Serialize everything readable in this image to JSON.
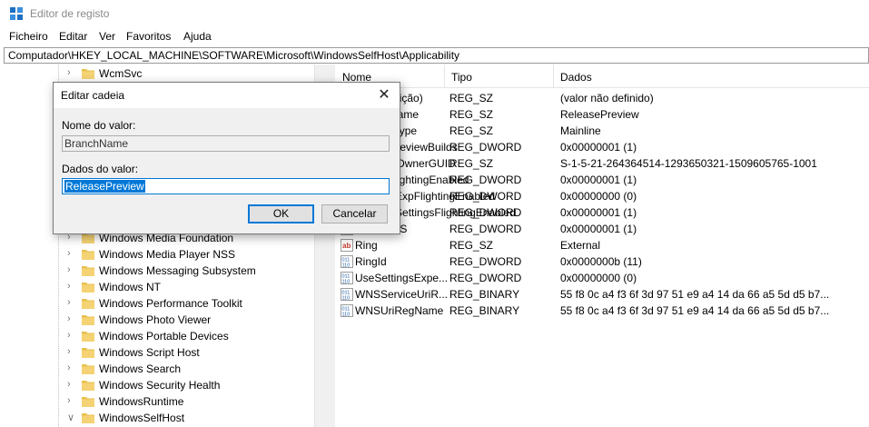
{
  "window": {
    "title": "Editor de registo",
    "icon": "registry-editor-icon"
  },
  "menu": [
    "Ficheiro",
    "Editar",
    "Ver",
    "Favoritos",
    "Ajuda"
  ],
  "address": "Computador\\HKEY_LOCAL_MACHINE\\SOFTWARE\\Microsoft\\WindowsSelfHost\\Applicability",
  "tree": {
    "items": [
      {
        "label": "WcmSvc",
        "expander": "chevron-right-icon"
      },
      {
        "label": "Windows Media Foundation",
        "expander": "chevron-right-icon"
      },
      {
        "label": "Windows Media Player NSS",
        "expander": "chevron-right-icon"
      },
      {
        "label": "Windows Messaging Subsystem",
        "expander": "chevron-right-icon"
      },
      {
        "label": "Windows NT",
        "expander": "chevron-right-icon"
      },
      {
        "label": "Windows Performance Toolkit",
        "expander": "chevron-right-icon"
      },
      {
        "label": "Windows Photo Viewer",
        "expander": "chevron-right-icon"
      },
      {
        "label": "Windows Portable Devices",
        "expander": "chevron-right-icon"
      },
      {
        "label": "Windows Script Host",
        "expander": "chevron-right-icon"
      },
      {
        "label": "Windows Search",
        "expander": "chevron-right-icon"
      },
      {
        "label": "Windows Security Health",
        "expander": "chevron-right-icon"
      },
      {
        "label": "WindowsRuntime",
        "expander": "chevron-right-icon"
      },
      {
        "label": "WindowsSelfHost",
        "expander": "chevron-down-icon"
      }
    ]
  },
  "list": {
    "columns": [
      "Nome",
      "Tipo",
      "Dados"
    ],
    "rows": [
      {
        "name": "(Predefinição)",
        "type": "REG_SZ",
        "data": "(valor não definido)",
        "icon": "string-value-icon"
      },
      {
        "name": "BranchName",
        "type": "REG_SZ",
        "data": "ReleasePreview",
        "icon": "string-value-icon"
      },
      {
        "name": "ContentType",
        "type": "REG_SZ",
        "data": "Mainline",
        "icon": "string-value-icon"
      },
      {
        "name": "EnablePreviewBuilds",
        "type": "REG_DWORD",
        "data": "0x00000001 (1)",
        "icon": "binary-value-icon"
      },
      {
        "name": "FlightingOwnerGUID",
        "type": "REG_SZ",
        "data": "S-1-5-21-264364514-1293650321-1509605765-1001",
        "icon": "string-value-icon"
      },
      {
        "name": "IsBuildFlightingEnabled",
        "type": "REG_DWORD",
        "data": "0x00000001 (1)",
        "icon": "binary-value-icon"
      },
      {
        "name": "IsConfigExpFlightingEnabled",
        "type": "REG_DWORD",
        "data": "0x00000000 (0)",
        "icon": "binary-value-icon"
      },
      {
        "name": "IsConfigSettingsFlightingEnabled",
        "type": "REG_DWORD",
        "data": "0x00000001 (1)",
        "icon": "binary-value-icon"
      },
      {
        "name": "IsRetailOS",
        "type": "REG_DWORD",
        "data": "0x00000001 (1)",
        "icon": "binary-value-icon"
      },
      {
        "name": "Ring",
        "type": "REG_SZ",
        "data": "External",
        "icon": "string-value-icon"
      },
      {
        "name": "RingId",
        "type": "REG_DWORD",
        "data": "0x0000000b (11)",
        "icon": "binary-value-icon"
      },
      {
        "name": "UseSettingsExpe...",
        "type": "REG_DWORD",
        "data": "0x00000000 (0)",
        "icon": "binary-value-icon"
      },
      {
        "name": "WNSServiceUriR...",
        "type": "REG_BINARY",
        "data": "55 f8 0c a4 f3 6f 3d 97 51 e9 a4 14 da 66 a5 5d d5 b7...",
        "icon": "binary-value-icon"
      },
      {
        "name": "WNSUriRegName",
        "type": "REG_BINARY",
        "data": "55 f8 0c a4 f3 6f 3d 97 51 e9 a4 14 da 66 a5 5d d5 b7...",
        "icon": "binary-value-icon"
      }
    ]
  },
  "dialog": {
    "title": "Editar cadeia",
    "value_name_label": "Nome do valor:",
    "value_name": "BranchName",
    "value_data_label": "Dados do valor:",
    "value_data": "ReleasePreview",
    "ok_label": "OK",
    "cancel_label": "Cancelar",
    "close_glyph": "✕"
  },
  "colors": {
    "accent": "#0078d7",
    "folder": "#e8c14d",
    "dialog_bg": "#f0f0f0"
  }
}
